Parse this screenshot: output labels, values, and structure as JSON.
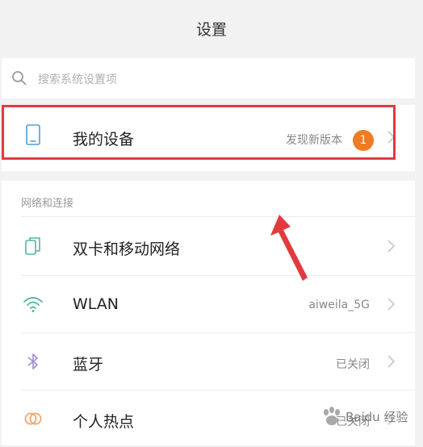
{
  "header": {
    "title": "设置"
  },
  "search": {
    "placeholder": "搜索系统设置项"
  },
  "my_device": {
    "title": "我的设备",
    "status": "发现新版本",
    "badge": "1",
    "icon": "phone-icon"
  },
  "sections": {
    "network": {
      "header": "网络和连接",
      "items": [
        {
          "title": "双卡和移动网络",
          "value": "",
          "icon": "dual-sim-icon"
        },
        {
          "title": "WLAN",
          "value": "aiweila_5G",
          "icon": "wifi-icon"
        },
        {
          "title": "蓝牙",
          "value": "已关闭",
          "icon": "bluetooth-icon"
        },
        {
          "title": "个人热点",
          "value": "已关闭",
          "icon": "hotspot-icon"
        }
      ]
    }
  },
  "colors": {
    "highlight": "#e23a3f",
    "badge": "#f07b24",
    "icon_teal": "#4fb7a6",
    "icon_orange": "#f2a56b",
    "icon_purple": "#a58bd6",
    "icon_blue": "#4a9fd8"
  },
  "watermark": {
    "text": "Baidu 经验"
  }
}
